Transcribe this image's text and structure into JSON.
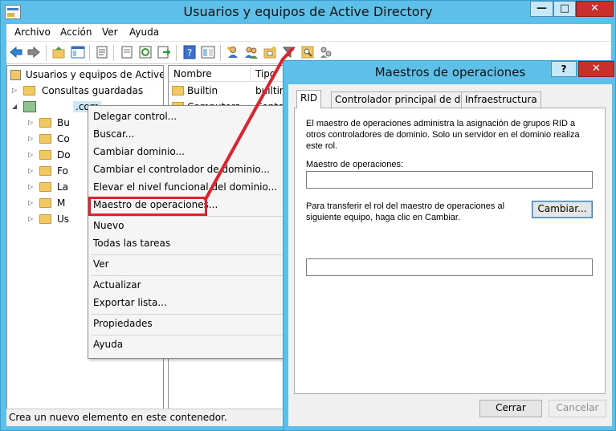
{
  "window": {
    "title": "Usuarios y equipos de Active Directory",
    "minimize": "—",
    "maximize": "□",
    "close": "✕"
  },
  "menubar": {
    "items": [
      "Archivo",
      "Acción",
      "Ver",
      "Ayuda"
    ]
  },
  "toolbar": {
    "icons": [
      "back-arrow-icon",
      "forward-arrow-icon",
      "up-folder-icon",
      "show-tree-icon",
      "properties-icon",
      "export-list-icon",
      "refresh-icon",
      "export-icon",
      "help-icon",
      "details-icon",
      "new-user-icon",
      "new-group-icon",
      "new-ou-icon",
      "filter-icon",
      "find-icon",
      "delegate-icon"
    ]
  },
  "tree": {
    "root": "Usuarios y equipos de Active Dir",
    "saved_queries": "Consultas guardadas",
    "domain": ".com",
    "children": [
      "Bu",
      "Co",
      "Do",
      "Fo",
      "La",
      "M",
      "Us"
    ]
  },
  "list": {
    "col_name": "Nombre",
    "col_type": "Tipo",
    "rows": [
      {
        "name": "Builtin",
        "type": "builtinD"
      },
      {
        "name": "Computers",
        "type": "Conten"
      }
    ]
  },
  "context_menu": {
    "items": [
      "Delegar control...",
      "Buscar...",
      "Cambiar dominio...",
      "Cambiar el controlador de dominio...",
      "Elevar el nivel funcional del dominio...",
      "Maestro de operaciones...",
      "Nuevo",
      "Todas las tareas",
      "Ver",
      "Actualizar",
      "Exportar lista...",
      "Propiedades",
      "Ayuda"
    ]
  },
  "status": {
    "text": "Crea un nuevo elemento en este contenedor."
  },
  "dialog": {
    "title": "Maestros de operaciones",
    "help": "?",
    "close": "✕",
    "tabs": [
      "RID",
      "Controlador principal de dominio",
      "Infraestructura"
    ],
    "description": "El maestro de operaciones administra la asignación de grupos RID a otros controladores de dominio. Solo un servidor en el dominio realiza este rol.",
    "operations_master_label": "Maestro de operaciones:",
    "operations_master_value": "",
    "transfer_text": "Para transferir el rol del maestro de operaciones al siguiente equipo, haga clic en Cambiar.",
    "change_button": "Cambiar...",
    "target_value": "",
    "close_button": "Cerrar",
    "cancel_button": "Cancelar"
  },
  "colors": {
    "titlebar": "#5cc0e8",
    "highlight_red": "#e0202a",
    "close_red": "#c9302c"
  }
}
